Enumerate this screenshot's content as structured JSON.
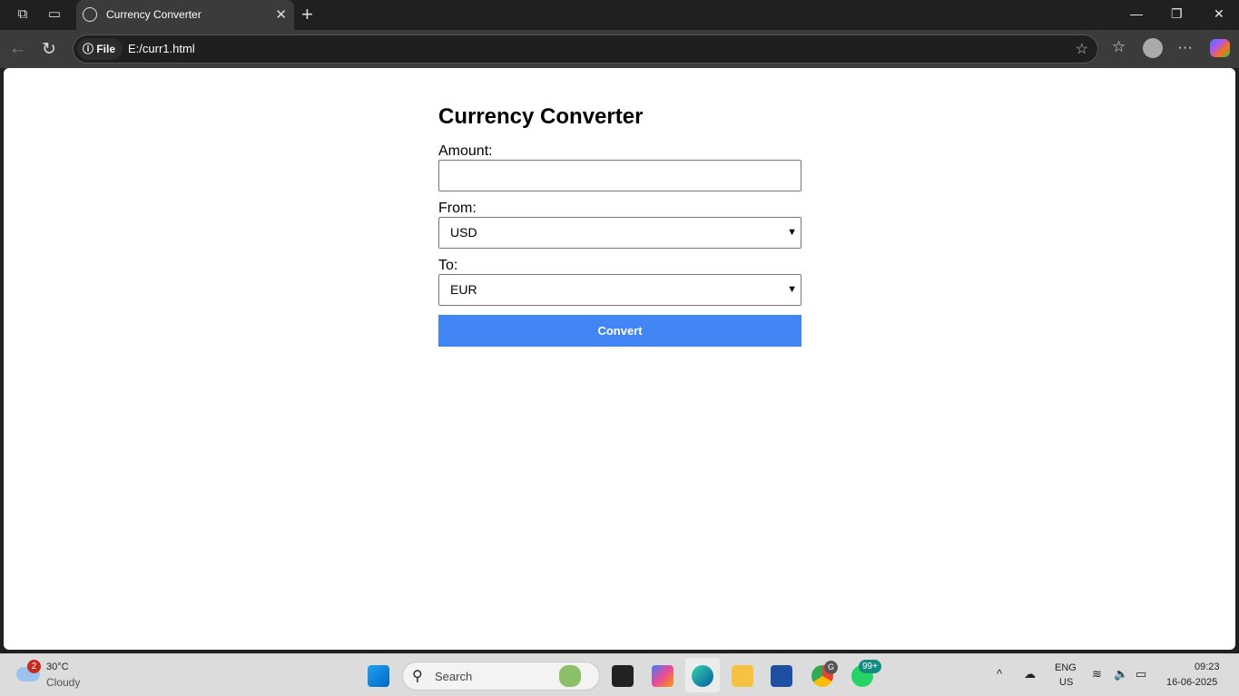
{
  "browser": {
    "tab_title": "Currency Converter",
    "chip_label": "File",
    "url": "E:/curr1.html"
  },
  "page": {
    "title": "Currency Converter",
    "amount_label": "Amount:",
    "amount_value": "",
    "from_label": "From:",
    "from_value": "USD",
    "to_label": "To:",
    "to_value": "EUR",
    "convert_label": "Convert",
    "accent": "#4285f4"
  },
  "taskbar": {
    "weather_temp": "30°C",
    "weather_desc": "Cloudy",
    "weather_badge": "2",
    "search_label": "Search",
    "chrome_badge": "G",
    "whatsapp_badge": "99+",
    "lang": "ENG",
    "region": "US",
    "time": "09:23",
    "date": "16-06-2025"
  }
}
